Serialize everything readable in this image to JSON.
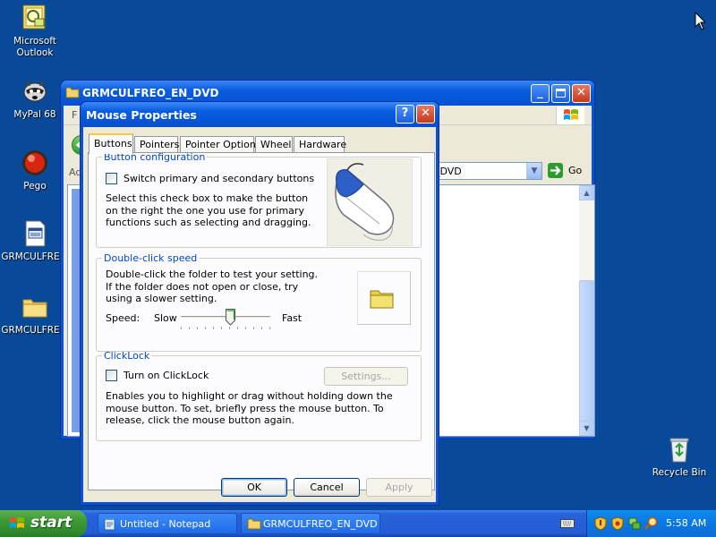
{
  "desktop": {
    "icons": [
      {
        "label_line1": "Microsoft",
        "label_line2": "Outlook"
      },
      {
        "label_line1": "MyPal 68",
        "label_line2": ""
      },
      {
        "label_line1": "Pego",
        "label_line2": ""
      },
      {
        "label_line1": "GRMCULFRE...",
        "label_line2": ""
      },
      {
        "label_line1": "GRMCULFRE...",
        "label_line2": ""
      }
    ],
    "recycle_bin": "Recycle Bin"
  },
  "explorer": {
    "title": "GRMCULFREO_EN_DVD",
    "menu_first": "F",
    "address_label": "Ac",
    "address_value": "_DVD",
    "go_label": "Go"
  },
  "dialog": {
    "title": "Mouse Properties",
    "tabs": [
      "Buttons",
      "Pointers",
      "Pointer Options",
      "Wheel",
      "Hardware"
    ],
    "button_config": {
      "legend": "Button configuration",
      "checkbox_label": "Switch primary and secondary buttons",
      "description": "Select this check box to make the button on the right the one you use for primary functions such as selecting and dragging."
    },
    "double_click": {
      "legend": "Double-click speed",
      "description": "Double-click the folder to test your setting. If the folder does not open or close, try using a slower setting.",
      "speed_label": "Speed:",
      "slow_label": "Slow",
      "fast_label": "Fast",
      "speed_value": 0.55
    },
    "clicklock": {
      "legend": "ClickLock",
      "checkbox_label": "Turn on ClickLock",
      "settings_button": "Settings...",
      "description": "Enables you to highlight or drag without holding down the mouse button. To set, briefly press the mouse button. To release, click the mouse button again."
    },
    "buttons": {
      "ok": "OK",
      "cancel": "Cancel",
      "apply": "Apply"
    }
  },
  "taskbar": {
    "start_label": "start",
    "tasks": [
      "Untitled - Notepad",
      "GRMCULFREO_EN_DVD"
    ],
    "clock": "5:58 AM"
  }
}
